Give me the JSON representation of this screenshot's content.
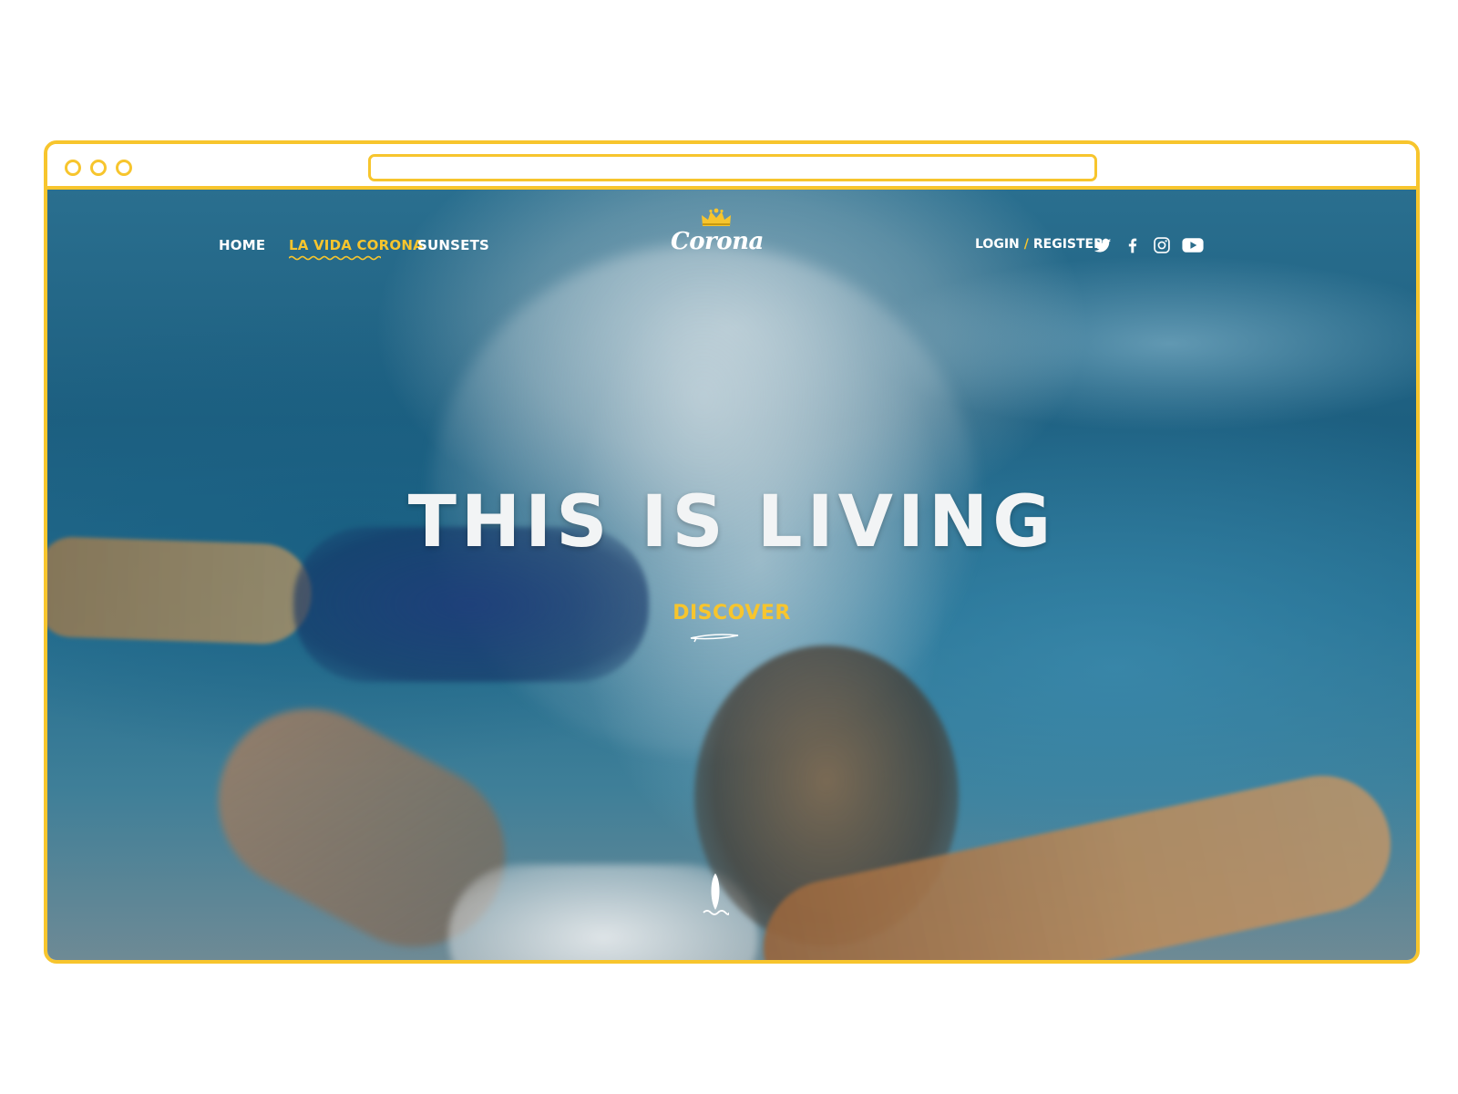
{
  "colors": {
    "accent": "#f7c52d",
    "nav_text": "#ffffff",
    "headline_text": "#f2f4f5"
  },
  "nav": {
    "home": "HOME",
    "la_vida_corona": "LA VIDA CORONA",
    "sunsets": "SUNSETS",
    "active": "la_vida_corona"
  },
  "logo": {
    "text": "Corona",
    "icon": "crown-icon"
  },
  "auth": {
    "login": "LOGIN",
    "separator": "/",
    "register": "REGISTER"
  },
  "social": {
    "icons": [
      "twitter-icon",
      "facebook-icon",
      "instagram-icon",
      "youtube-icon"
    ]
  },
  "hero": {
    "headline": "THIS IS LIVING",
    "cta": "DISCOVER",
    "cta_icon": "surfboard-icon",
    "scroll_icon": "surfboard-wave-icon"
  }
}
